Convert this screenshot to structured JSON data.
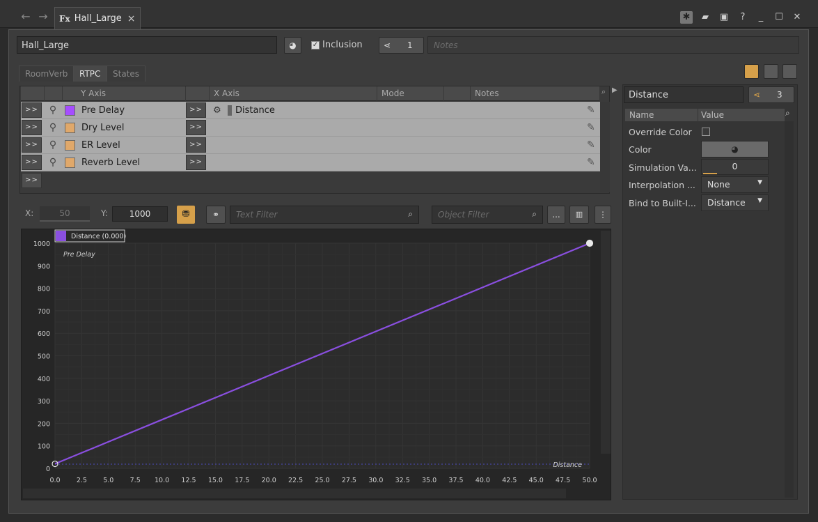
{
  "window": {
    "tab_icon": "Fx",
    "tab_title": "Hall_Large",
    "tab_close": "×",
    "nav_back": "←",
    "nav_forward": "→",
    "buttons": [
      "star-icon",
      "folder-icon",
      "save-icon",
      "help-icon",
      "minimize-icon",
      "maximize-icon",
      "close-icon"
    ]
  },
  "header": {
    "object_name": "Hall_Large",
    "inclusion_label": "Inclusion",
    "inclusion_checked": true,
    "ref_count": "1",
    "notes_placeholder": "Notes"
  },
  "subtabs": [
    "RoomVerb",
    "RTPC",
    "States"
  ],
  "active_subtab": "RTPC",
  "rtpc_grid": {
    "columns": [
      "Y Axis",
      "X Axis",
      "Mode",
      "Notes"
    ],
    "arrow_label": ">>",
    "rows": [
      {
        "y_axis": "Pre Delay",
        "color": "#a64dff",
        "x_axis": "Distance"
      },
      {
        "y_axis": "Dry Level",
        "color": "#e0a86a",
        "x_axis": ""
      },
      {
        "y_axis": "ER Level",
        "color": "#e0a86a",
        "x_axis": ""
      },
      {
        "y_axis": "Reverb Level",
        "color": "#e0a86a",
        "x_axis": ""
      }
    ]
  },
  "toolbar": {
    "x_label": "X:",
    "x_value": "50",
    "y_label": "Y:",
    "y_value": "1000",
    "text_filter_placeholder": "Text Filter",
    "object_filter_placeholder": "Object Filter",
    "more_label": "..."
  },
  "chart_data": {
    "type": "line",
    "series": [
      {
        "name": "Pre Delay",
        "color": "#8a4fe0",
        "x": [
          0,
          50
        ],
        "y": [
          20,
          1000
        ]
      }
    ],
    "legend": "Distance (0.000)",
    "series_label": "Pre Delay",
    "x_axis_label": "Distance",
    "xlim": [
      0,
      50
    ],
    "ylim": [
      0,
      1000
    ],
    "xticks": [
      "0.0",
      "2.5",
      "5.0",
      "7.5",
      "10.0",
      "12.5",
      "15.0",
      "17.5",
      "20.0",
      "22.5",
      "25.0",
      "27.5",
      "30.0",
      "32.5",
      "35.0",
      "37.5",
      "40.0",
      "42.5",
      "45.0",
      "47.5",
      "50.0"
    ],
    "yticks": [
      "0",
      "100",
      "200",
      "300",
      "400",
      "500",
      "600",
      "700",
      "800",
      "900",
      "1000"
    ],
    "grid": true
  },
  "right_panel": {
    "param_name": "Distance",
    "ref_count": "3",
    "columns": [
      "Name",
      "Value"
    ],
    "properties": [
      {
        "name": "Override Color",
        "value": "",
        "kind": "checkbox"
      },
      {
        "name": "Color",
        "value": "",
        "kind": "color"
      },
      {
        "name": "Simulation Va...",
        "value": "0",
        "kind": "slider"
      },
      {
        "name": "Interpolation ...",
        "value": "None",
        "kind": "dropdown"
      },
      {
        "name": "Bind to Built-I...",
        "value": "Distance",
        "kind": "dropdown"
      }
    ]
  }
}
